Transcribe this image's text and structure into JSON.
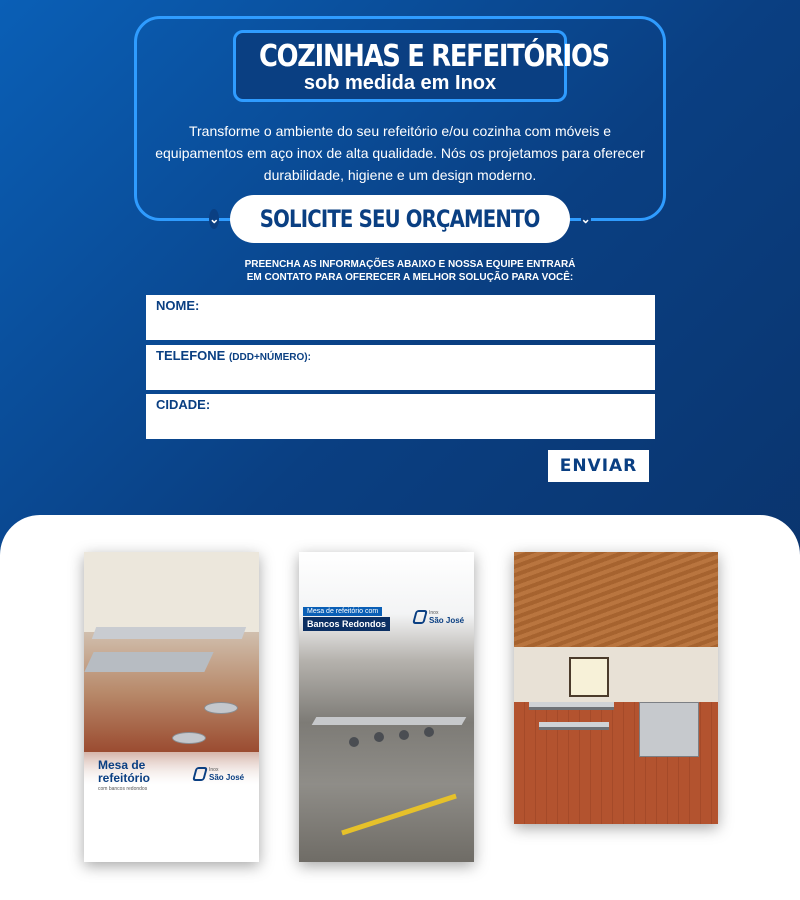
{
  "header": {
    "title": "COZINHAS E REFEITÓRIOS",
    "subtitle": "sob medida em Inox",
    "intro": "Transforme o ambiente do seu refeitório e/ou cozinha com móveis e equipamentos em aço inox de alta qualidade. Nós os projetamos para oferecer durabilidade, higiene e um design moderno."
  },
  "cta": {
    "label": "SOLICITE SEU ORÇAMENTO",
    "note_line1": "PREENCHA AS INFORMAÇÕES ABAIXO E NOSSA EQUIPE ENTRARÁ",
    "note_line2": "EM CONTATO PARA OFERECER A MELHOR SOLUÇÃO PARA VOCÊ:"
  },
  "form": {
    "name_label": "NOME:",
    "phone_label": "TELEFONE",
    "phone_hint": "(DDD+NÚMERO):",
    "city_label": "CIDADE:",
    "submit_label": "ENVIAR"
  },
  "gallery": {
    "card1": {
      "title_line1": "Mesa de",
      "title_line2": "refeitório",
      "subtitle": "com bancos redondos",
      "logo_small": "Inox",
      "logo_name": "São José"
    },
    "card2": {
      "tag1": "Mesa de refeitório com",
      "tag2": "Bancos Redondos",
      "logo_small": "Inox",
      "logo_name": "São José"
    }
  },
  "icons": {
    "chevron": "chevron-down-double-icon",
    "logo": "inox-sao-jose-logo-icon"
  },
  "colors": {
    "brand_dark": "#0a3f82",
    "brand_light": "#2f9cff"
  }
}
